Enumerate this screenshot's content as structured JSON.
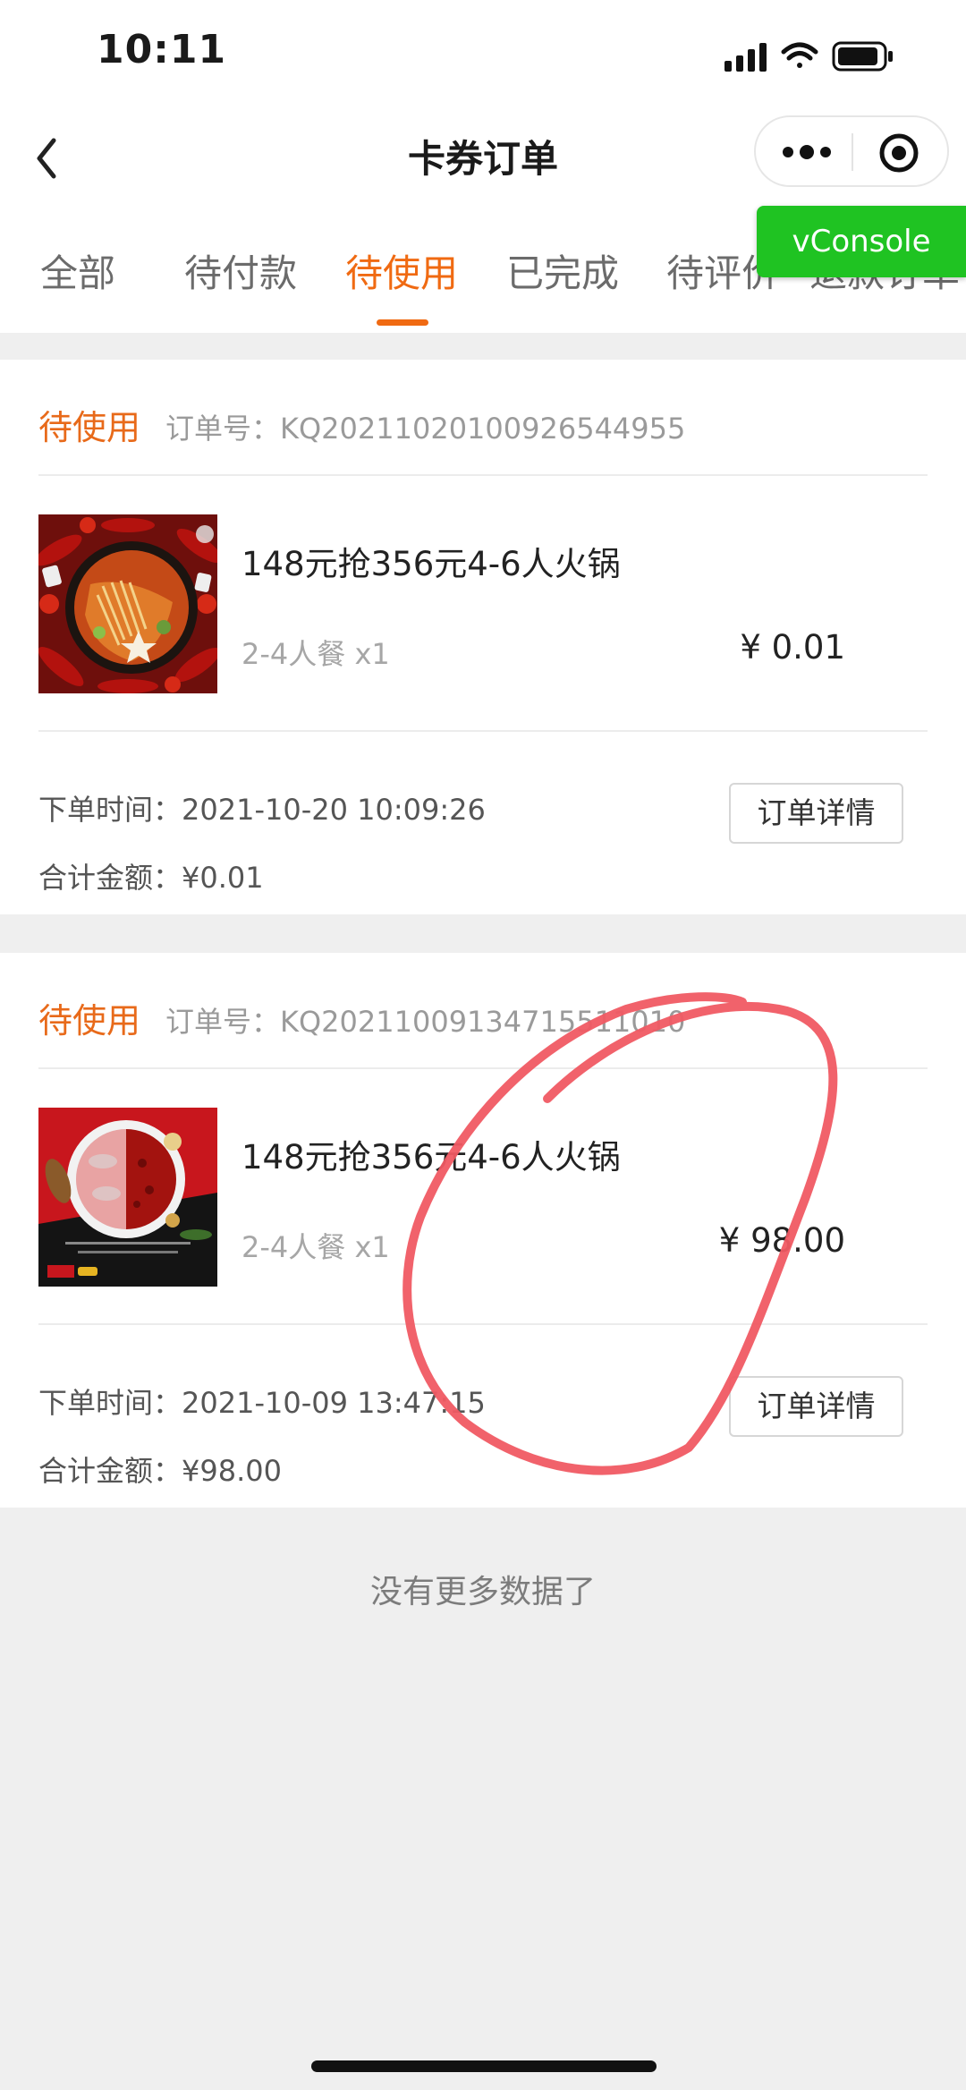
{
  "status_bar": {
    "time": "10:11"
  },
  "nav": {
    "title": "卡券订单"
  },
  "vconsole": {
    "label": "vConsole"
  },
  "tabs": [
    {
      "label": "全部",
      "active": false
    },
    {
      "label": "待付款",
      "active": false
    },
    {
      "label": "待使用",
      "active": true
    },
    {
      "label": "已完成",
      "active": false
    },
    {
      "label": "待评价",
      "active": false
    },
    {
      "label": "退款订单",
      "active": false
    }
  ],
  "orders": [
    {
      "status": "待使用",
      "order_no": "订单号：KQ20211020100926544955",
      "product_name": "148元抢356元4-6人火锅",
      "spec": "2-4人餐 x1",
      "price": "¥ 0.01",
      "order_time": "下单时间：2021-10-20 10:09:26",
      "total": "合计金额：¥0.01",
      "detail_button": "订单详情"
    },
    {
      "status": "待使用",
      "order_no": "订单号：KQ20211009134715511010",
      "product_name": "148元抢356元4-6人火锅",
      "spec": "2-4人餐 x1",
      "price": "¥ 98.00",
      "order_time": "下单时间：2021-10-09 13:47:15",
      "total": "合计金额：¥98.00",
      "detail_button": "订单详情"
    }
  ],
  "footer": {
    "no_more": "没有更多数据了"
  },
  "colors": {
    "accent": "#f06a12",
    "vconsole": "#1fc322",
    "annotation": "#f05a63"
  }
}
